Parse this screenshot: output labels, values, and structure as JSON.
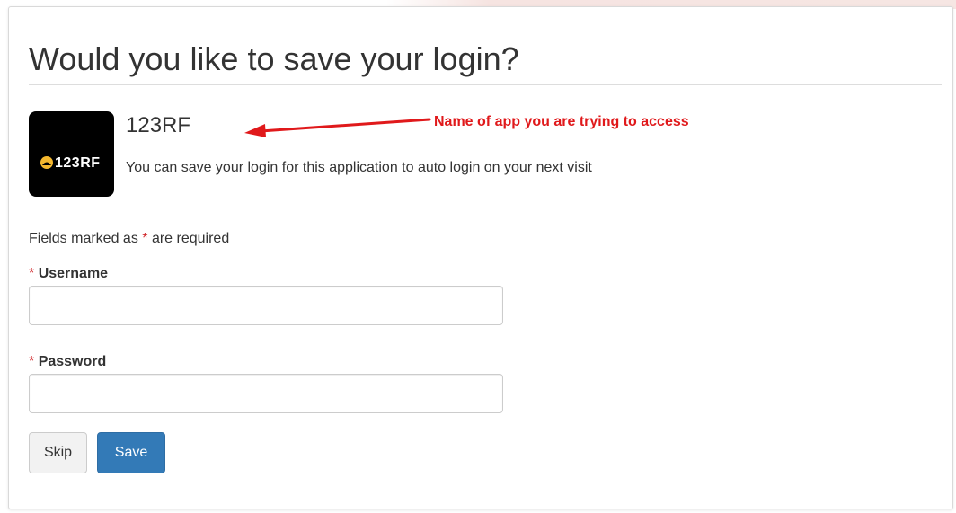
{
  "page": {
    "title": "Would you like to save your login?"
  },
  "app": {
    "logo_text": "123RF",
    "name": "123RF",
    "description": "You can save your login for this application to auto login on your next visit"
  },
  "annotation": {
    "text": "Name of app you are trying to access",
    "color": "#e0191b"
  },
  "form": {
    "required_note_prefix": "Fields marked as ",
    "required_star": "*",
    "required_note_suffix": " are required",
    "username": {
      "label": "Username",
      "value": "",
      "placeholder": ""
    },
    "password": {
      "label": "Password",
      "value": "",
      "placeholder": ""
    }
  },
  "buttons": {
    "skip_label": "Skip",
    "save_label": "Save"
  },
  "colors": {
    "primary": "#337ab7",
    "required": "#d0262a",
    "logo_background": "#000000",
    "logo_accent": "#f5b82e"
  }
}
